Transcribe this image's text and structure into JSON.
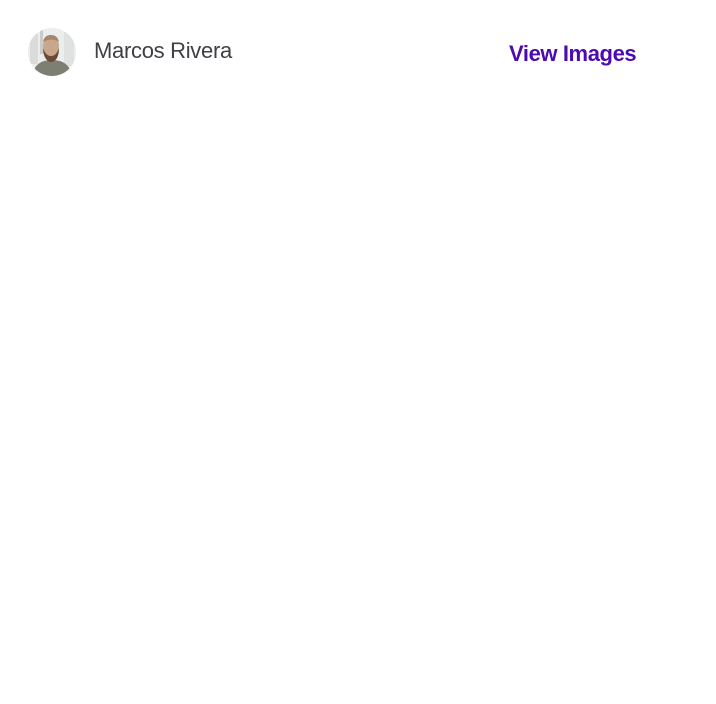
{
  "author": {
    "name": "Marcos Rivera",
    "avatar_icon": "user-avatar-photo"
  },
  "actions": {
    "view_images_label": "View Images"
  },
  "colors": {
    "link": "#4c0ab0",
    "name_text": "#3f3f46",
    "background": "#ffffff"
  }
}
